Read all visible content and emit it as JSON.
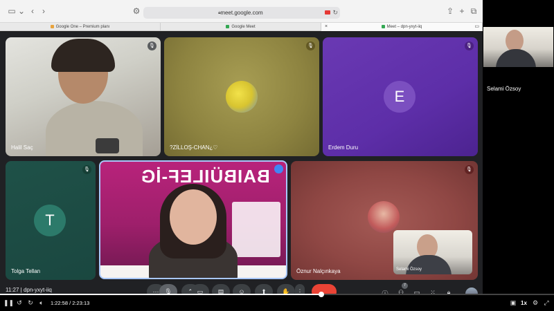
{
  "browser": {
    "url": "meet.google.com",
    "tabs": [
      {
        "label": "Google One – Premium planı"
      },
      {
        "label": "Google Meet"
      },
      {
        "label": "Meet – dpn-yxyt-iiq"
      }
    ]
  },
  "meet": {
    "meeting_info": "11:27  |  dpn-yxyt-iiq",
    "participants": [
      {
        "name": "Halil Saç"
      },
      {
        "name": "?ZİLLOŞ-CHAN¿♡"
      },
      {
        "name": "Erdem Duru",
        "initial": "E",
        "color": "#7b4fc0"
      },
      {
        "name": "Tolga Tellan",
        "initial": "T",
        "color": "#2c7a6a"
      },
      {
        "name": "Öznur Nalçınkaya"
      }
    ],
    "presenter_banner": "BAIBÜILEF-İG",
    "pip_name": "Selami Özsoy",
    "people_count": "7"
  },
  "right_panel": {
    "name": "Selami Özsoy"
  },
  "player": {
    "time": "1:22:58 / 2:23:13",
    "speed": "1x",
    "progress_fraction": 0.58
  },
  "colors": {
    "end_call": "#ea4335",
    "accent": "#a8c7fa"
  }
}
